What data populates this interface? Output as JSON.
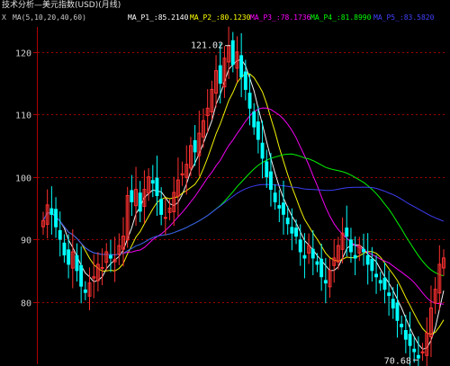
{
  "window": {
    "title": "技术分析—美元指数(USD)(月线)"
  },
  "legend": {
    "marker": "X",
    "ma_params": "MA(5,10,20,40,60)",
    "items": [
      {
        "label": "MA_P1_:85.2140",
        "color": "#ffffff"
      },
      {
        "label": "MA_P2_:80.1230",
        "color": "#ffff00"
      },
      {
        "label": "MA_P3_:78.1736",
        "color": "#ff00ff"
      },
      {
        "label": "MA_P4_:81.8990",
        "color": "#00ff00"
      },
      {
        "label": "MA_P5_:83.5820",
        "color": "#4040ff"
      }
    ]
  },
  "chart_data": {
    "type": "candlestick",
    "title": "技术分析—美元指数(USD)(月线)",
    "ylim": [
      70,
      124
    ],
    "yticks": [
      80,
      90,
      100,
      110,
      120
    ],
    "grid": true,
    "annotations": [
      {
        "label": "121.02",
        "value": 121.02
      },
      {
        "label": "70.68",
        "value": 70.68
      }
    ],
    "closes": [
      93,
      95.5,
      94,
      92,
      90,
      87.5,
      86,
      88,
      85,
      82.5,
      81.5,
      83,
      84,
      86,
      85.5,
      88,
      87,
      86.8,
      89,
      90.5,
      97,
      96,
      98,
      94.5,
      98,
      100,
      99,
      97,
      94,
      93.5,
      95,
      97.5,
      99.5,
      100.5,
      102,
      105,
      104,
      107,
      109,
      111,
      114,
      117,
      115,
      119,
      121,
      118,
      120,
      116,
      114,
      111,
      108,
      106,
      103,
      100,
      98,
      96,
      95,
      94,
      92.5,
      91,
      90.5,
      88,
      87,
      89,
      87,
      86,
      84,
      83,
      85,
      87,
      89,
      91,
      90.5,
      88,
      87,
      89,
      88,
      86,
      85,
      84,
      83,
      82,
      81,
      79,
      77,
      76,
      74,
      73,
      72,
      71,
      72,
      75,
      79,
      82,
      86,
      87
    ],
    "ma_colors": [
      "#ffffff",
      "#ffff00",
      "#ff00ff",
      "#00ff00",
      "#4040ff"
    ],
    "ma_periods": [
      5,
      10,
      20,
      40,
      60
    ]
  }
}
